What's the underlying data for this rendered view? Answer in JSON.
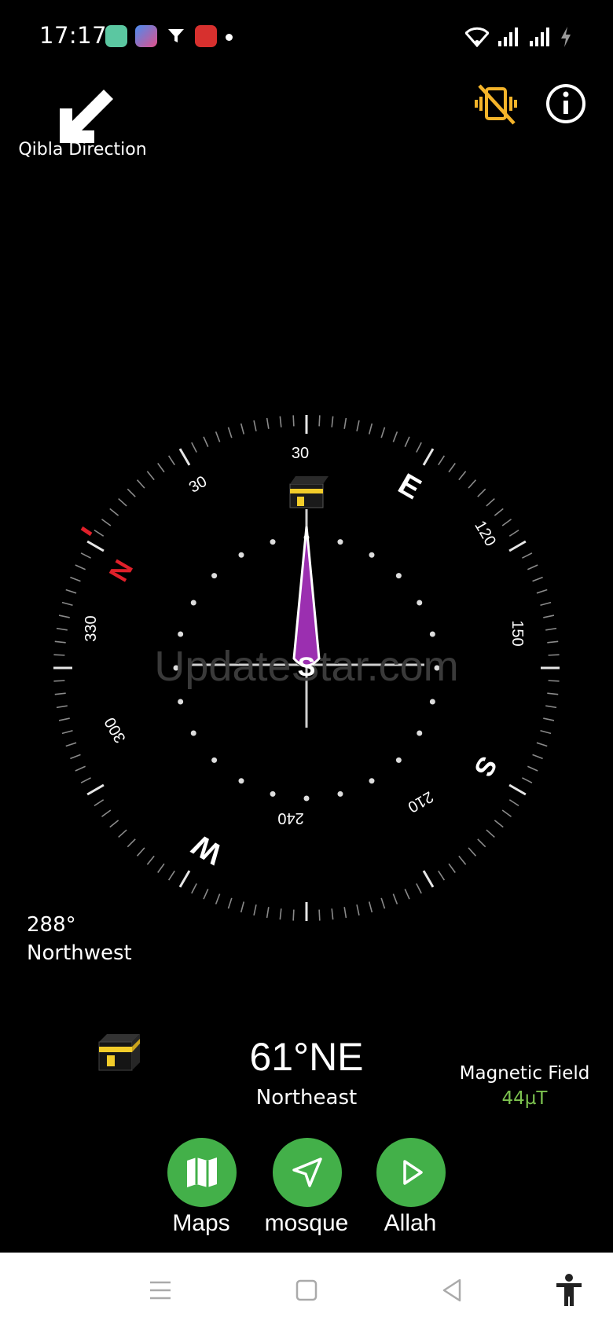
{
  "status_bar": {
    "time": "17:17"
  },
  "header": {
    "qibla_label": "Qibla Direction",
    "vibrate_icon": "vibrate-off-icon",
    "info_icon": "info-icon"
  },
  "compass": {
    "cardinals": {
      "N": "N",
      "E": "E",
      "S": "S",
      "W": "W"
    },
    "degree_labels": [
      "30",
      "120",
      "150",
      "210",
      "240",
      "300",
      "330",
      "30"
    ],
    "center_glyph": "S",
    "watermark": "UpdateStar.com",
    "colors": {
      "north": "#e0202a",
      "needle": "#9b2fb0",
      "kaaba_gold": "#f2cc2a"
    }
  },
  "heading": {
    "degrees": "288°",
    "direction": "Northwest"
  },
  "qibla": {
    "bearing": "61°NE",
    "name": "Northeast"
  },
  "magnetic": {
    "label": "Magnetic Field",
    "value": "44µT",
    "color": "#7cc24f"
  },
  "actions": [
    {
      "label": "Maps",
      "icon": "map-icon"
    },
    {
      "label": "mosque",
      "icon": "navigation-arrow-icon"
    },
    {
      "label": "Allah",
      "icon": "play-icon"
    }
  ],
  "nav": {
    "icons": [
      "menu-icon",
      "home-square-icon",
      "back-triangle-icon",
      "accessibility-icon"
    ]
  }
}
